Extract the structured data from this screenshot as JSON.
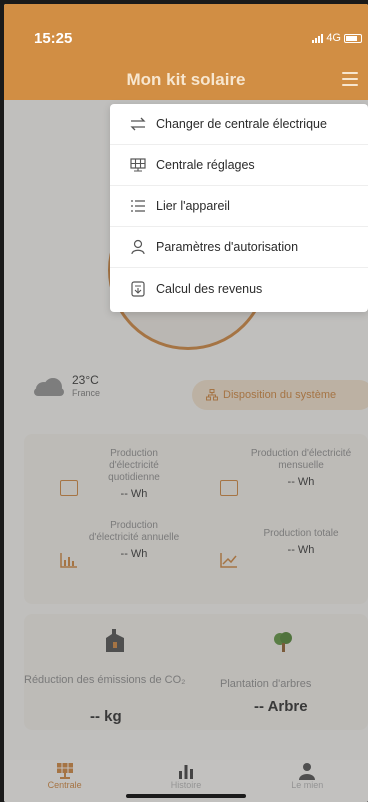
{
  "status_bar": {
    "time": "15:25",
    "network": "4G"
  },
  "header": {
    "title": "Mon kit solaire"
  },
  "weather": {
    "temperature": "23°C",
    "location": "France"
  },
  "system_layout_button": "Disposition du système",
  "stats": {
    "daily": {
      "label": "Production d'électricité quotidienne",
      "value": "-- Wh"
    },
    "monthly": {
      "label": "Production d'électricité mensuelle",
      "value": "-- Wh"
    },
    "annual": {
      "label": "Production d'électricité annuelle",
      "value": "-- Wh"
    },
    "total": {
      "label": "Production totale",
      "value": "-- Wh"
    }
  },
  "eco": {
    "co2_label": "Réduction des émissions de CO₂",
    "co2_value": "-- kg",
    "trees_label": "Plantation d'arbres",
    "trees_value": "-- Arbre"
  },
  "menu": {
    "items": [
      {
        "label": "Changer de centrale électrique",
        "icon": "switch-arrows-icon"
      },
      {
        "label": "Centrale réglages",
        "icon": "solar-panel-icon"
      },
      {
        "label": "Lier l'appareil",
        "icon": "list-link-icon"
      },
      {
        "label": "Paramètres d'autorisation",
        "icon": "user-icon"
      },
      {
        "label": "Calcul des revenus",
        "icon": "calculator-icon"
      }
    ]
  },
  "tabs": [
    {
      "label": "Centrale",
      "icon": "solar-panel-icon",
      "active": true
    },
    {
      "label": "Histoire",
      "icon": "bar-chart-icon",
      "active": false
    },
    {
      "label": "Le mien",
      "icon": "user-icon",
      "active": false
    }
  ],
  "colors": {
    "accent": "#d18e44",
    "background": "#f1efec"
  }
}
